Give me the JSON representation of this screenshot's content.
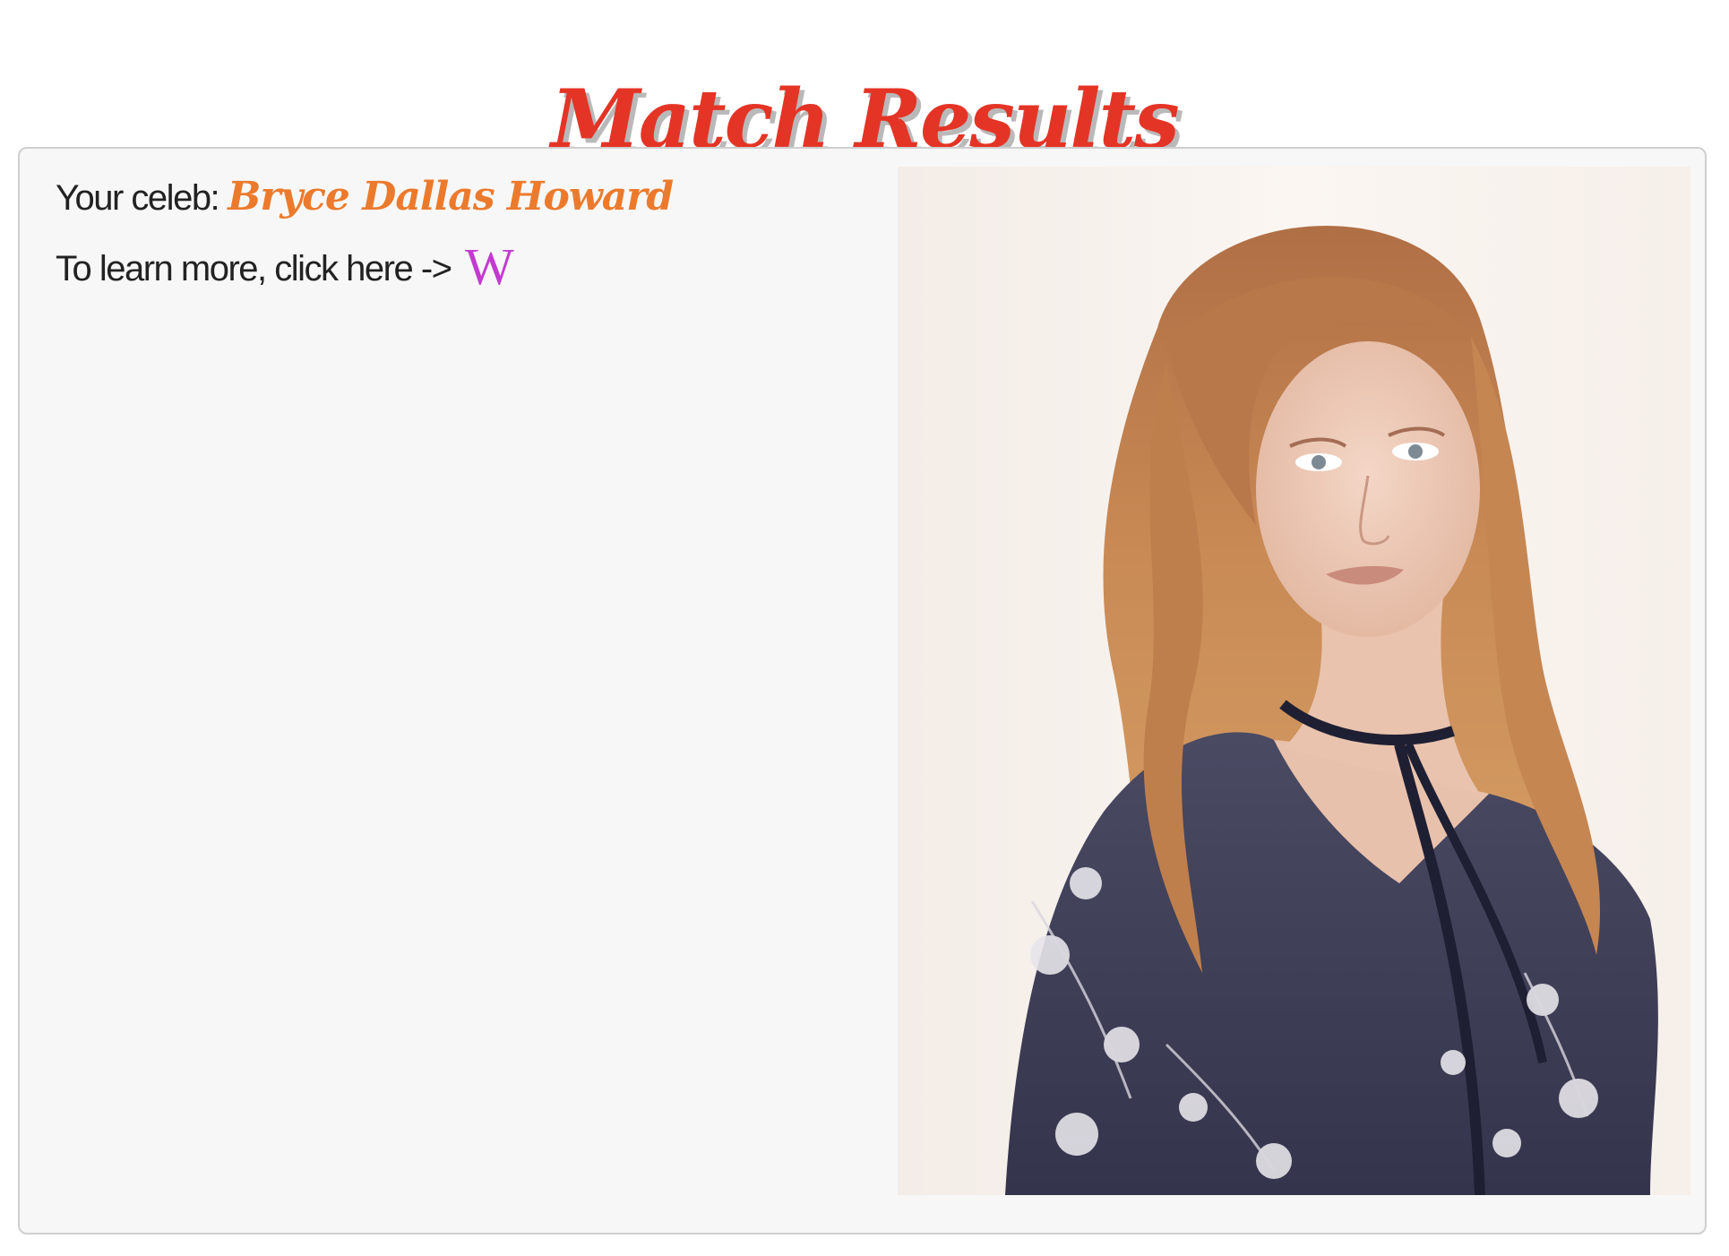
{
  "header": {
    "title": "Match Results"
  },
  "result": {
    "celeb_label": "Your celeb:",
    "celeb_name": "Bryce Dallas Howard",
    "learn_more_label": "To learn more, click here ->",
    "wiki_link_text": "W",
    "wiki_icon": "wikipedia-w-icon"
  },
  "colors": {
    "title": "#e43426",
    "title_shadow": "#b9b9b9",
    "celeb_name": "#ec7a2c",
    "wiki_link": "#c43ad0",
    "card_background": "#f7f7f7"
  }
}
